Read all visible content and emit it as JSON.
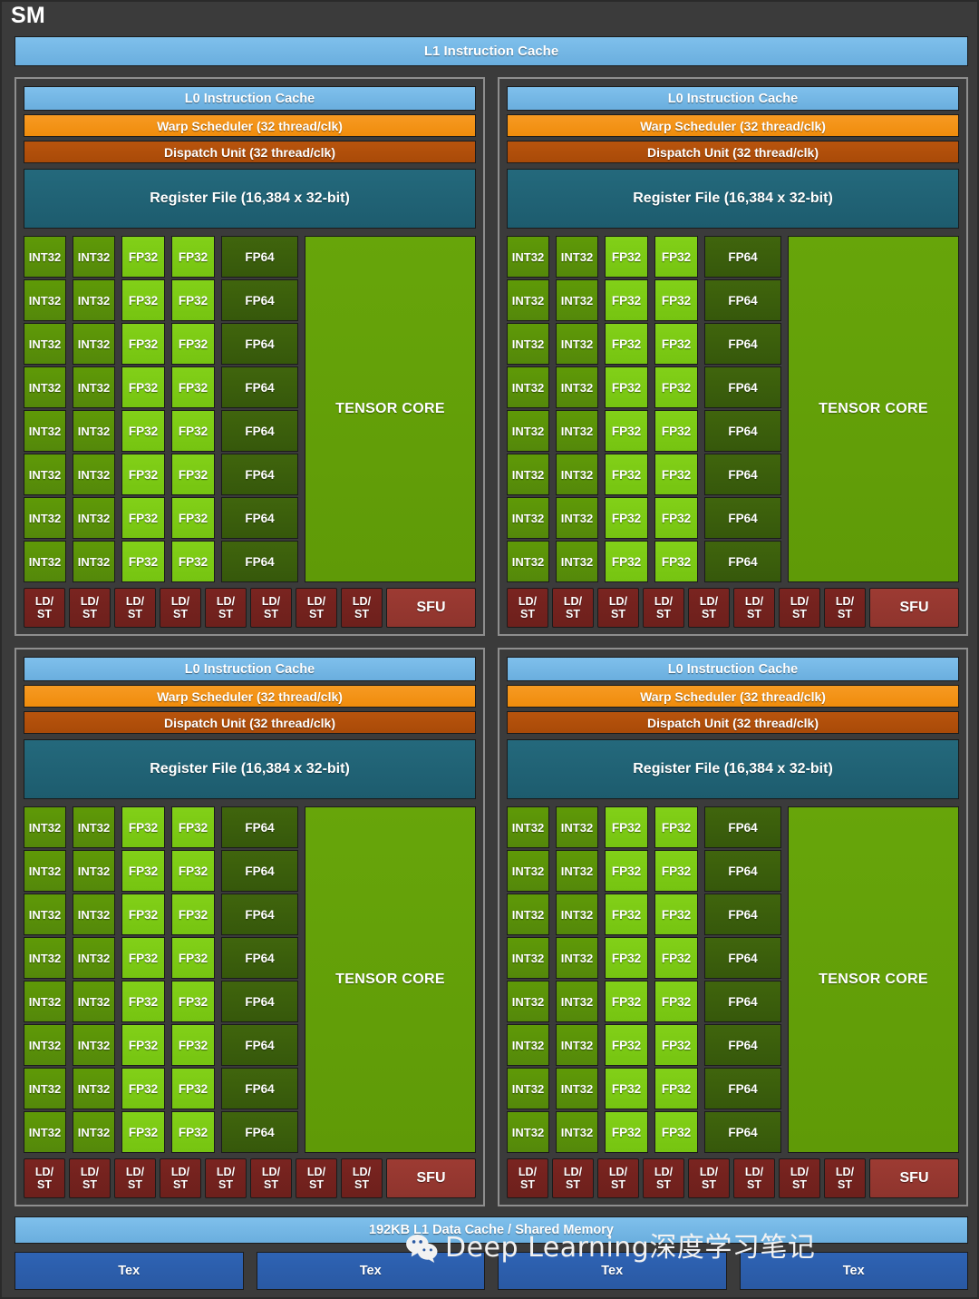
{
  "diagram": {
    "title": "SM",
    "l1_instruction_cache": "L1 Instruction Cache",
    "l1_data_cache": "192KB L1 Data Cache / Shared Memory"
  },
  "partition": {
    "l0_instruction_cache": "L0 Instruction Cache",
    "warp_scheduler": "Warp Scheduler (32 thread/clk)",
    "dispatch_unit": "Dispatch Unit (32 thread/clk)",
    "register_file": "Register File (16,384 x 32-bit)",
    "tensor_core": "TENSOR CORE",
    "int32": "INT32",
    "fp32": "FP32",
    "fp64": "FP64",
    "ldst_line1": "LD/",
    "ldst_line2": "ST",
    "sfu": "SFU",
    "core_rows": 8,
    "int32_cols": 2,
    "fp32_cols": 2,
    "fp64_cols": 1,
    "ldst_count": 8
  },
  "partitions": [
    {
      "id": "partition-1",
      "position": "top-left"
    },
    {
      "id": "partition-2",
      "position": "top-right"
    },
    {
      "id": "partition-3",
      "position": "bottom-left"
    },
    {
      "id": "partition-4",
      "position": "bottom-right"
    }
  ],
  "tex_units": [
    {
      "label": "Tex"
    },
    {
      "label": "Tex"
    },
    {
      "label": "Tex"
    },
    {
      "label": "Tex"
    }
  ],
  "watermark": {
    "icon": "wechat-icon",
    "text": "Deep Learning深度学习笔记"
  },
  "colors": {
    "background": "#3b3b3b",
    "cache_blue": "#6aaede",
    "warp_orange": "#ef8c0c",
    "dispatch_brown": "#a94a08",
    "register_teal": "#1d5c6e",
    "int32_green": "#54880a",
    "fp32_green": "#76c411",
    "fp64_green": "#36580b",
    "tensor_green": "#5f9a07",
    "ldst_red": "#6d201c",
    "sfu_red": "#8e342d",
    "tex_blue": "#2a59a3"
  }
}
